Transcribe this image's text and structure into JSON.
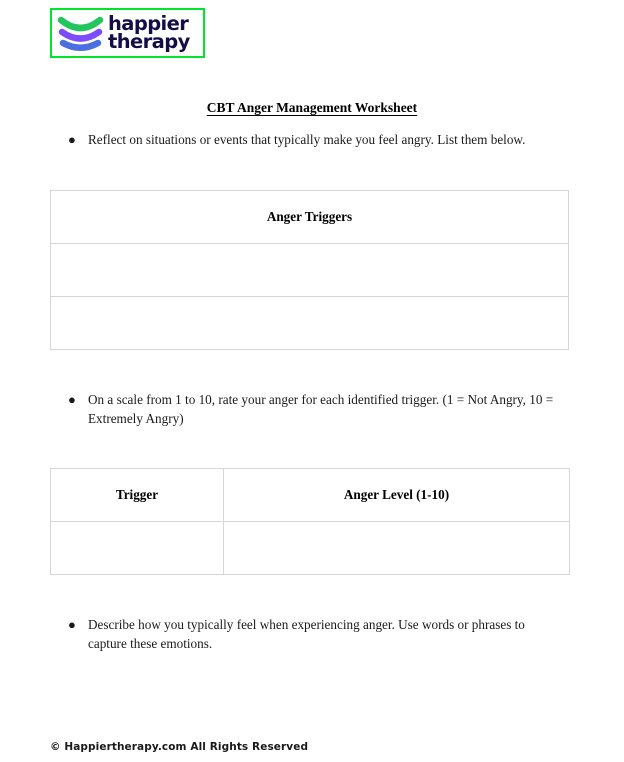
{
  "logo": {
    "brand_line1": "happier",
    "brand_line2": "therapy",
    "icon_name": "happier-therapy-arcs-logo",
    "border_color": "#00e529",
    "text_color": "#140d47",
    "arc_colors": [
      "#22c55e",
      "#7c4dff",
      "#4a6fe0"
    ]
  },
  "document": {
    "title": "CBT Anger Management Worksheet",
    "bullets": [
      "Reflect on situations or events that typically make you feel angry. List them below.",
      "On a scale from 1 to 10, rate your anger for each identified trigger. (1 = Not Angry, 10 = Extremely Angry)",
      "Describe how you typically feel when experiencing anger. Use words or phrases to capture these emotions."
    ],
    "bullet_marker": "●"
  },
  "tables": {
    "triggers": {
      "headers": [
        "Anger Triggers"
      ],
      "rows": [
        [
          ""
        ],
        [
          ""
        ]
      ]
    },
    "levels": {
      "headers": [
        "Trigger",
        "Anger Level (1-10)"
      ],
      "rows": [
        [
          "",
          ""
        ]
      ]
    }
  },
  "footer": {
    "copyright": "© Happiertherapy.com All Rights Reserved"
  }
}
